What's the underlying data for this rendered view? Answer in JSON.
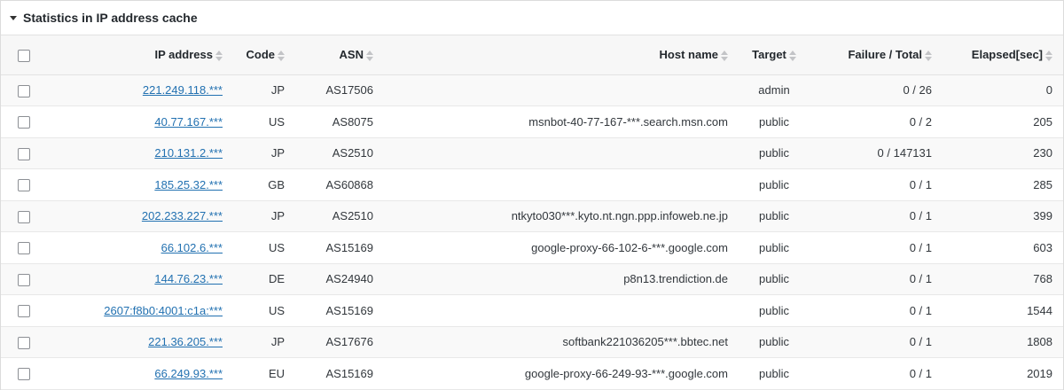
{
  "panel": {
    "title": "Statistics in IP address cache"
  },
  "columns": {
    "ip": "IP address",
    "code": "Code",
    "asn": "ASN",
    "host": "Host name",
    "target": "Target",
    "failure": "Failure / Total",
    "elapsed": "Elapsed[sec]"
  },
  "rows": [
    {
      "ip": "221.249.118.***",
      "code": "JP",
      "asn": "AS17506",
      "host": "",
      "target": "admin",
      "failure": "0 / 26",
      "elapsed": "0"
    },
    {
      "ip": "40.77.167.***",
      "code": "US",
      "asn": "AS8075",
      "host": "msnbot-40-77-167-***.search.msn.com",
      "target": "public",
      "failure": "0 / 2",
      "elapsed": "205"
    },
    {
      "ip": "210.131.2.***",
      "code": "JP",
      "asn": "AS2510",
      "host": "",
      "target": "public",
      "failure": "0 / 147131",
      "elapsed": "230"
    },
    {
      "ip": "185.25.32.***",
      "code": "GB",
      "asn": "AS60868",
      "host": "",
      "target": "public",
      "failure": "0 / 1",
      "elapsed": "285"
    },
    {
      "ip": "202.233.227.***",
      "code": "JP",
      "asn": "AS2510",
      "host": "ntkyto030***.kyto.nt.ngn.ppp.infoweb.ne.jp",
      "target": "public",
      "failure": "0 / 1",
      "elapsed": "399"
    },
    {
      "ip": "66.102.6.***",
      "code": "US",
      "asn": "AS15169",
      "host": "google-proxy-66-102-6-***.google.com",
      "target": "public",
      "failure": "0 / 1",
      "elapsed": "603"
    },
    {
      "ip": "144.76.23.***",
      "code": "DE",
      "asn": "AS24940",
      "host": "p8n13.trendiction.de",
      "target": "public",
      "failure": "0 / 1",
      "elapsed": "768"
    },
    {
      "ip": "2607:f8b0:4001:c1a:***",
      "code": "US",
      "asn": "AS15169",
      "host": "",
      "target": "public",
      "failure": "0 / 1",
      "elapsed": "1544"
    },
    {
      "ip": "221.36.205.***",
      "code": "JP",
      "asn": "AS17676",
      "host": "softbank221036205***.bbtec.net",
      "target": "public",
      "failure": "0 / 1",
      "elapsed": "1808"
    },
    {
      "ip": "66.249.93.***",
      "code": "EU",
      "asn": "AS15169",
      "host": "google-proxy-66-249-93-***.google.com",
      "target": "public",
      "failure": "0 / 1",
      "elapsed": "2019"
    }
  ]
}
